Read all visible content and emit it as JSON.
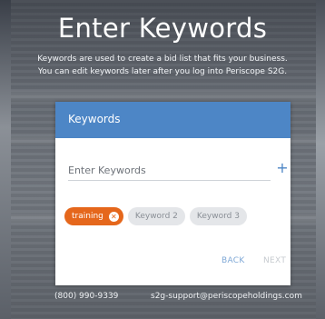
{
  "header": {
    "title": "Enter Keywords",
    "subtitle_line1": "Keywords are used to create a bid list that fits your business.",
    "subtitle_line2": "You can edit keywords later after you log into Periscope S2G."
  },
  "card": {
    "header_label": "Keywords",
    "input_placeholder": "Enter Keywords",
    "add_icon": "+",
    "chips": [
      {
        "label": "training",
        "active": true
      },
      {
        "label": "Keyword 2",
        "active": false
      },
      {
        "label": "Keyword 3",
        "active": false
      }
    ],
    "back_label": "BACK",
    "next_label": "NEXT"
  },
  "footer": {
    "phone": "(800) 990-9339",
    "email": "s2g-support@periscopeholdings.com"
  },
  "colors": {
    "accent_blue": "#4d86c6",
    "chip_active": "#e5671c",
    "chip_inactive": "#e4e6e9"
  }
}
